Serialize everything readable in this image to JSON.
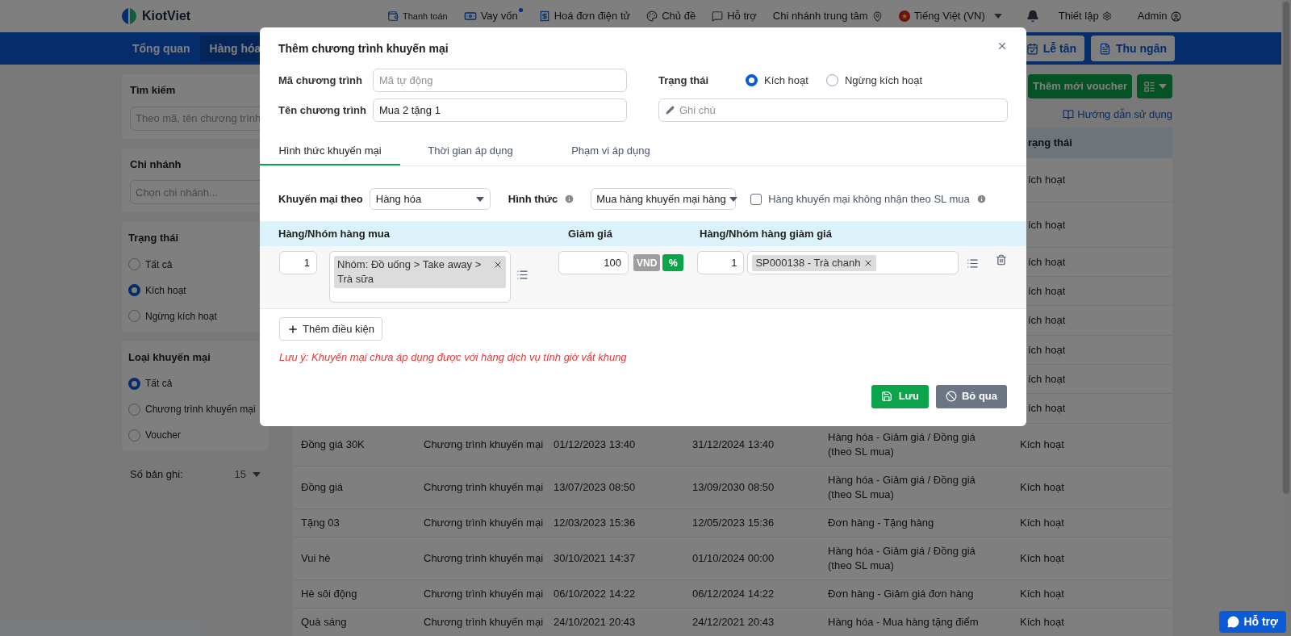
{
  "header": {
    "logo": "KiotViet",
    "items": [
      {
        "kind": "pay",
        "label": "Thanh toán"
      },
      {
        "kind": "loan",
        "label": "Vay vốn",
        "dot": true
      },
      {
        "kind": "invoice",
        "label": "Hoá đơn điện tử"
      },
      {
        "kind": "theme",
        "label": "Chủ đề"
      },
      {
        "kind": "help",
        "label": "Hỗ trợ"
      },
      {
        "kind": "branch",
        "label": "Chi nhánh trung tâm"
      },
      {
        "kind": "lang",
        "label": "Tiếng Việt (VN)"
      }
    ],
    "settings": "Thiết lập",
    "user": "Admin"
  },
  "nav": {
    "items": [
      {
        "label": "Tổng quan",
        "selected": false
      },
      {
        "label": "Hàng hóa",
        "selected": true
      }
    ],
    "right_buttons": [
      {
        "kind": "reception",
        "label": "Lễ tân"
      },
      {
        "kind": "cashier",
        "label": "Thu ngân"
      }
    ]
  },
  "sidebar": {
    "search": {
      "title": "Tìm kiếm",
      "placeholder": "Theo mã, tên chương trình"
    },
    "branch": {
      "title": "Chi nhánh",
      "placeholder": "Chọn chi nhánh..."
    },
    "groups": [
      {
        "title": "Trạng thái",
        "options": [
          {
            "label": "Tất cả",
            "selected": false
          },
          {
            "label": "Kích hoạt",
            "selected": true
          },
          {
            "label": "Ngừng kích hoạt",
            "selected": false
          }
        ]
      },
      {
        "title": "Loại khuyến mại",
        "options": [
          {
            "label": "Tất cả",
            "selected": true
          },
          {
            "label": "Chương trình khuyến mại",
            "selected": false
          },
          {
            "label": "Voucher",
            "selected": false
          }
        ]
      }
    ],
    "records_label": "Số bản ghi:",
    "records_value": "15"
  },
  "toolbar": {
    "add_voucher": "Thêm mới voucher",
    "guide": "Hướng dẫn sử dụng"
  },
  "table": {
    "status_header": "rạng thái",
    "rows": [
      {
        "status": "ích hoạt"
      },
      {
        "status": "ích hoạt"
      },
      {
        "status": "ích hoạt"
      },
      {
        "status": "ích hoạt"
      },
      {
        "status": "ích hoạt"
      },
      {
        "status": "ích hoạt"
      },
      {
        "status": "ích hoạt"
      },
      {
        "status": "ích hoạt"
      },
      {
        "name": "Đồng giá 30K",
        "type": "Chương trình khuyến mại",
        "start": "01/12/2023 13:40",
        "end": "31/12/2024 13:40",
        "kind": "Hàng hóa - Giảm giá / Đồng giá (theo SL mua)",
        "status": "Kích hoạt"
      },
      {
        "name": "Đồng giá",
        "type": "Chương trình khuyến mại",
        "start": "13/07/2023 08:50",
        "end": "13/09/2030 08:50",
        "kind": "Hàng hóa - Giảm giá / Đồng giá (theo SL mua)",
        "status": "Kích hoạt"
      },
      {
        "name": "Tặng 03",
        "type": "Chương trình khuyến mại",
        "start": "12/03/2023 15:36",
        "end": "12/05/2023 15:36",
        "kind": "Đơn hàng - Tặng hàng",
        "status": "Kích hoạt"
      },
      {
        "name": "Vui hè",
        "type": "Chương trình khuyến mại",
        "start": "30/10/2021 14:37",
        "end": "01/10/2024 00:00",
        "kind": "Hàng hóa - Giảm giá / Đồng giá (theo SL mua)",
        "status": "Kích hoạt"
      },
      {
        "name": "Hè sôi động",
        "type": "Chương trình khuyến mại",
        "start": "06/10/2022 14:22",
        "end": "06/12/2024 14:22",
        "kind": "Đơn hàng - Giảm giá đơn hàng",
        "status": "Kích hoạt"
      },
      {
        "name": "Quà sáng",
        "type": "Chương trình khuyến mại",
        "start": "24/10/2021 20:43",
        "end": "24/12/2021 20:43",
        "kind": "Hàng hóa - Mua hàng tặng điểm",
        "status": "Kích hoạt"
      }
    ]
  },
  "support_button": "Hỗ trợ",
  "modal": {
    "title": "Thêm chương trình khuyến mại",
    "code": {
      "label": "Mã chương trình",
      "placeholder": "Mã tự động"
    },
    "name": {
      "label": "Tên chương trình",
      "value": "Mua 2 tặng 1"
    },
    "status": {
      "label": "Trạng thái",
      "options": [
        {
          "label": "Kích hoạt",
          "selected": true
        },
        {
          "label": "Ngừng kích hoạt",
          "selected": false
        }
      ]
    },
    "note": {
      "placeholder": "Ghi chú"
    },
    "tabs": [
      {
        "label": "Hình thức khuyến mại",
        "selected": true
      },
      {
        "label": "Thời gian áp dụng",
        "selected": false
      },
      {
        "label": "Phạm vi áp dụng",
        "selected": false
      }
    ],
    "promo_by": {
      "label": "Khuyến mại theo",
      "value": "Hàng hóa"
    },
    "form": {
      "label": "Hình thức",
      "value": "Mua hàng khuyến mại hàng"
    },
    "no_qty": {
      "label": "Hàng khuyến mại không nhận theo SL mua",
      "checked": false
    },
    "columns": [
      "Hàng/Nhóm hàng mua",
      "Giảm giá",
      "Hàng/Nhóm hàng giảm giá"
    ],
    "condition": {
      "buy_qty": "1",
      "buy_tag": "Nhóm: Đồ uống > Take away > Trà sữa",
      "discount": "100",
      "units": [
        {
          "label": "VND",
          "selected": false
        },
        {
          "label": "%",
          "selected": true
        }
      ],
      "get_qty": "1",
      "get_tag": "SP000138 - Trà chanh"
    },
    "add_condition": "Thêm điều kiện",
    "warning": "Lưu ý: Khuyến mại chưa áp dụng được với hàng dịch vụ tính giờ vắt khung",
    "save": "Lưu",
    "cancel": "Bỏ qua"
  }
}
